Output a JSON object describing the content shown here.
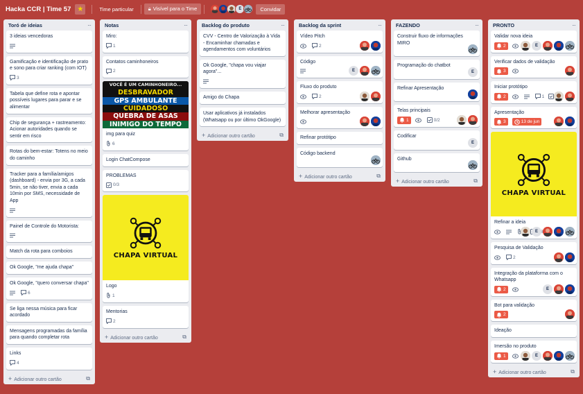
{
  "header": {
    "title": "Hacka CCR | Time 57",
    "team_label": "Time particular",
    "visibility_label": "Visível para o Time",
    "invite_label": "Convidar",
    "members": [
      "red",
      "blue",
      "man",
      "E",
      "bike"
    ]
  },
  "colors": {
    "board_bg": "#b5403a",
    "list_bg": "#ebecf0",
    "badge_red": "#eb5a46",
    "chapa_yellow": "#f5eb1f"
  },
  "add_card_label": "Adicionar outro cartão",
  "lists": [
    {
      "title": "Toró de ideias",
      "cards": [
        {
          "title": "3 ideias vencedoras",
          "badges": [
            {
              "icon": "description-icon"
            }
          ]
        },
        {
          "title": "Gamificação e identificação de prato e sono para criar ranking (com IOT)",
          "badges": [
            {
              "icon": "comment-icon",
              "text": "3"
            }
          ]
        },
        {
          "title": "Tabela que define rota e apontar possíveis lugares para parar e se alimentar"
        },
        {
          "title": "Chip de segurança + rastreamento: Acionar autoridades quando se sentir em risco"
        },
        {
          "title": "Rotas do bem-estar: Totens no meio do caminho"
        },
        {
          "title": "Tracker para a família/amigos (dashboard) - envia por 3G, a cada 5min, se não tiver, envia a cada 10min por SMS, necessidade de App",
          "badges": [
            {
              "icon": "description-icon"
            }
          ]
        },
        {
          "title": "Painel de Controle do Motorista:",
          "badges": [
            {
              "icon": "description-icon"
            }
          ]
        },
        {
          "title": "Match da rota para comboios"
        },
        {
          "title": "Ok Google, \"me ajuda chapa\""
        },
        {
          "title": "Ok Google, \"quero conversar chapa\"",
          "badges": [
            {
              "icon": "description-icon"
            },
            {
              "icon": "comment-icon",
              "text": "6"
            }
          ]
        },
        {
          "title": "Se liga nessa música para ficar acordado"
        },
        {
          "title": "Mensagens programadas da família para quando completar rota"
        },
        {
          "title": "Links",
          "badges": [
            {
              "icon": "comment-icon",
              "text": "4"
            }
          ]
        }
      ]
    },
    {
      "title": "Notas",
      "cards": [
        {
          "title": "Miro:",
          "badges": [
            {
              "icon": "comment-icon",
              "text": "1"
            }
          ]
        },
        {
          "title": "Contatos caminhoneiros",
          "badges": [
            {
              "icon": "comment-icon",
              "text": "2"
            }
          ]
        },
        {
          "title": "img para quiz",
          "cover": "quiz",
          "cover_lines": [
            "VOCÊ É UM CAMINHONEIRO...",
            "DESBRAVADOR",
            "GPS AMBULANTE",
            "CUIDADOSO",
            "QUEBRA DE ASAS",
            "INIMIGO DO TEMPO"
          ],
          "badges": [
            {
              "icon": "attachment-icon",
              "text": "6"
            }
          ]
        },
        {
          "title": "Login ChatCompose"
        },
        {
          "title": "PROBLEMAS",
          "badges": [
            {
              "icon": "checklist-icon",
              "text": "0/3"
            }
          ]
        },
        {
          "title": "Logo",
          "cover": "chapa",
          "cover_text": "CHAPA VIRTUAL",
          "badges": [
            {
              "icon": "attachment-icon",
              "text": "1"
            }
          ]
        },
        {
          "title": "Mentorias",
          "badges": [
            {
              "icon": "comment-icon",
              "text": "2"
            }
          ]
        }
      ]
    },
    {
      "title": "Backlog do produto",
      "cards": [
        {
          "title": "CVV - Centro de Valorização à Vida - Encaminhar chamadas e agendamentos com voluntários"
        },
        {
          "title": "Ok Google, \"chapa vou viajar agora\"...",
          "badges": [
            {
              "icon": "description-icon"
            }
          ]
        },
        {
          "title": "Amigo do Chapa"
        },
        {
          "title": "Usar aplicativos já instalados (Whatsapp ou por último OkGoogle)"
        }
      ]
    },
    {
      "title": "Backlog da sprint",
      "cards": [
        {
          "title": "Vídeo Pitch",
          "badges": [
            {
              "icon": "eye-icon"
            },
            {
              "icon": "comment-icon",
              "text": "2"
            }
          ],
          "members": [
            "red",
            "blue"
          ]
        },
        {
          "title": "Código",
          "badges": [
            {
              "icon": "description-icon"
            }
          ],
          "members": [
            "E",
            "red",
            "bike"
          ]
        },
        {
          "title": "Fluxo do produto",
          "badges": [
            {
              "icon": "eye-icon"
            },
            {
              "icon": "comment-icon",
              "text": "2"
            }
          ],
          "members": [
            "man",
            "red"
          ]
        },
        {
          "title": "Melhorar apresentação",
          "badges": [
            {
              "icon": "eye-icon"
            }
          ],
          "members": [
            "red",
            "blue"
          ]
        },
        {
          "title": "Refinar protótipo"
        },
        {
          "title": "Código backend",
          "members": [
            "bike"
          ]
        }
      ]
    },
    {
      "title": "FAZENDO",
      "cards": [
        {
          "title": "Construir fluxo de informações MIRO",
          "members": [
            "bike"
          ]
        },
        {
          "title": "Programação do chatbot",
          "members": [
            "E"
          ]
        },
        {
          "title": "Refinar Apresentação",
          "members": [
            "blue"
          ]
        },
        {
          "title": "Telas principais",
          "badges": [
            {
              "icon": "alert-icon",
              "text": "1",
              "red": true
            },
            {
              "icon": "eye-icon"
            },
            {
              "icon": "checklist-icon",
              "text": "0/2"
            }
          ],
          "members": [
            "man",
            "red"
          ]
        },
        {
          "title": "Codificar",
          "members": [
            "E"
          ]
        },
        {
          "title": "Github",
          "members": [
            "bike"
          ]
        }
      ]
    },
    {
      "title": "PRONTO",
      "cards": [
        {
          "title": "Validar nova ideia",
          "badges": [
            {
              "icon": "alert-icon",
              "text": "2",
              "red": true
            },
            {
              "icon": "eye-icon"
            }
          ],
          "members": [
            "man",
            "E",
            "red",
            "blue",
            "bike"
          ]
        },
        {
          "title": "Verificar dados de validação",
          "badges": [
            {
              "icon": "alert-icon",
              "text": "3",
              "red": true
            },
            {
              "icon": "eye-icon"
            }
          ],
          "members": [
            "red"
          ]
        },
        {
          "title": "Iniciar protótipo",
          "badges": [
            {
              "icon": "alert-icon",
              "text": "2",
              "red": true
            },
            {
              "icon": "eye-icon"
            },
            {
              "icon": "description-icon"
            },
            {
              "icon": "comment-icon",
              "text": "1"
            },
            {
              "icon": "checklist-icon",
              "text": "2/6"
            }
          ],
          "members": [
            "man",
            "red"
          ]
        },
        {
          "title": "Apresentação",
          "badges": [
            {
              "icon": "alert-icon",
              "text": "3",
              "red": true
            },
            {
              "icon": "clock-icon",
              "text": "13 de jun",
              "red": true
            }
          ],
          "members": [
            "red",
            "blue"
          ]
        },
        {
          "title": "Refinar a ideia",
          "cover": "chapa",
          "cover_text": "CHAPA VIRTUAL",
          "badges": [
            {
              "icon": "eye-icon"
            },
            {
              "icon": "description-icon"
            },
            {
              "icon": "attachment-icon",
              "text": "1"
            },
            {
              "icon": "checklist-icon",
              "text": "0/8"
            }
          ],
          "members": [
            "man",
            "E",
            "red",
            "blue",
            "bike"
          ]
        },
        {
          "title": "Pesquisa de Validação",
          "badges": [
            {
              "icon": "eye-icon"
            },
            {
              "icon": "comment-icon",
              "text": "2"
            }
          ],
          "members": [
            "red",
            "blue"
          ]
        },
        {
          "title": "Integração da plataforma com o Whatsapp",
          "badges": [
            {
              "icon": "alert-icon",
              "text": "2",
              "red": true
            },
            {
              "icon": "eye-icon"
            }
          ],
          "members": [
            "E",
            "red",
            "blue"
          ]
        },
        {
          "title": "Bot para validação",
          "badges": [
            {
              "icon": "alert-icon",
              "text": "2",
              "red": true
            }
          ],
          "members": [
            "red"
          ]
        },
        {
          "title": "Ideação"
        },
        {
          "title": "Imersão no produto",
          "badges": [
            {
              "icon": "alert-icon",
              "text": "1",
              "red": true
            },
            {
              "icon": "eye-icon"
            }
          ],
          "members": [
            "man",
            "E",
            "red",
            "blue",
            "bike"
          ]
        }
      ]
    }
  ]
}
